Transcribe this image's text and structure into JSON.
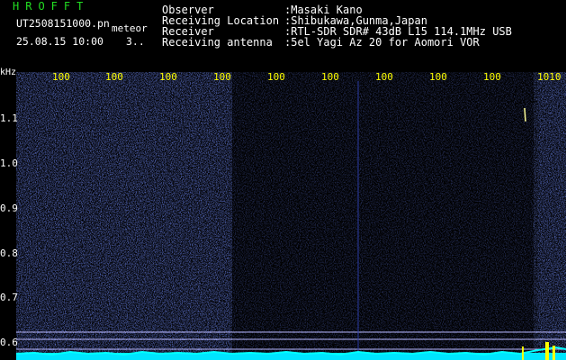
{
  "header": {
    "app_title": "HROFFT",
    "file_name": "UT2508151000.pn",
    "meteor_label": "meteor",
    "datetime": "25.08.15 10:00",
    "count": "3.."
  },
  "meta": [
    {
      "key": "Observer",
      "value": ":Masaki Kano"
    },
    {
      "key": "Receiving Location",
      "value": ":Shibukawa,Gunma,Japan"
    },
    {
      "key": "Receiver",
      "value": ":RTL-SDR SDR# 43dB L15 114.1MHz USB"
    },
    {
      "key": "Receiving antenna",
      "value": ":5el Yagi Az 20 for Aomori VOR"
    }
  ],
  "axis": {
    "y_unit": "kHz",
    "y_ticks": [
      "1.1",
      "1.0",
      "0.9",
      "0.8",
      "0.7",
      "0.6"
    ],
    "x_ticks": [
      "100",
      "100",
      "100",
      "100",
      "100",
      "100",
      "100",
      "100",
      "100",
      "1010"
    ]
  },
  "colors": {
    "background": "#000000",
    "noise": "#1a2a9a",
    "marker": "#ffff00",
    "trace": "#00ffff",
    "title": "#22dd22"
  }
}
